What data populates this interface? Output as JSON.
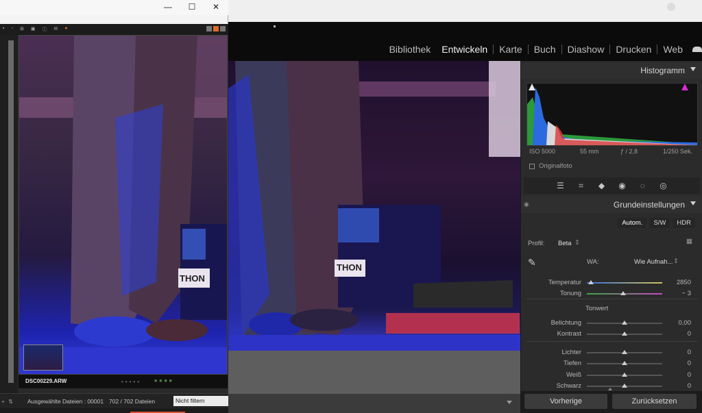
{
  "topbar": {
    "modules": [
      "Bibliothek",
      "Entwickeln",
      "Karte",
      "Buch",
      "Diashow",
      "Drucken",
      "Web"
    ],
    "active_module": "Entwickeln"
  },
  "histogram": {
    "title": "Histogramm",
    "iso": "ISO 5000",
    "focal": "55 mm",
    "aperture": "ƒ / 2,8",
    "shutter": "1/250 Sek.",
    "original_label": "Originalfoto"
  },
  "basic": {
    "title": "Grundeinstellungen",
    "modes": [
      "Autom.",
      "S/W",
      "HDR"
    ],
    "profile_label": "Profil:",
    "profile_value": "Beta",
    "wb_label": "WA:",
    "wb_value": "Wie Aufnah...",
    "tone_heading": "Tonwert",
    "sliders": [
      {
        "label": "Temperatur",
        "value": "2850",
        "position": 0.05
      },
      {
        "label": "Tonung",
        "value": "− 3",
        "position": 0.48
      },
      {
        "label": "Belichtung",
        "value": "0,00",
        "position": 0.5
      },
      {
        "label": "Kontrast",
        "value": "0",
        "position": 0.5
      },
      {
        "label": "Lichter",
        "value": "0",
        "position": 0.5
      },
      {
        "label": "Tiefen",
        "value": "0",
        "position": 0.5
      },
      {
        "label": "Weiß",
        "value": "0",
        "position": 0.5
      },
      {
        "label": "Schwarz",
        "value": "0",
        "position": 0.5
      }
    ]
  },
  "buttons": {
    "previous": "Vorherige",
    "reset": "Zurücksetzen"
  },
  "second_window": {
    "controls": {
      "minimize": "—",
      "maximize": "☐",
      "close": "✕"
    },
    "filename": "DSC00229.ARW",
    "selected_files": "Ausgewählte Dateien : 00001",
    "file_count": "702 / 702 Dateien",
    "filter": "Nicht filtern"
  },
  "colors": {
    "accent_blue": "#3a3ad0",
    "stage_purple": "#2e1738"
  }
}
